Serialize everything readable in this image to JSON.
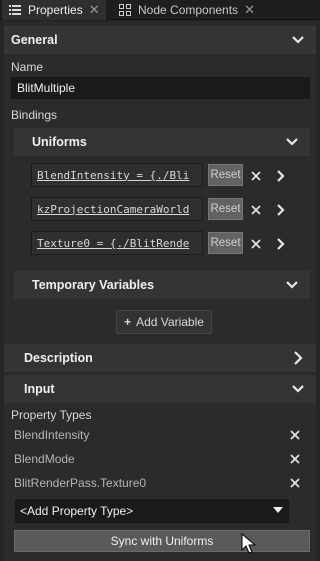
{
  "tabs": [
    {
      "label": "Properties",
      "icon": "list-icon"
    },
    {
      "label": "Node Components",
      "icon": "components-icon"
    }
  ],
  "sections": {
    "general": "General",
    "uniforms": "Uniforms",
    "temporary_variables": "Temporary Variables",
    "description": "Description",
    "input": "Input"
  },
  "name": {
    "label": "Name",
    "value": "BlitMultiple"
  },
  "bindings": {
    "label": "Bindings",
    "rows": [
      {
        "text": "BlendIntensity = {./Bli",
        "reset": "Reset"
      },
      {
        "text": "kzProjectionCameraWorld",
        "reset": "Reset"
      },
      {
        "text": "Texture0 = {./BlitRende",
        "reset": "Reset"
      }
    ],
    "add_variable": "Add Variable"
  },
  "property_types": {
    "label": "Property Types",
    "items": [
      "BlendIntensity",
      "BlendMode",
      "BlitRenderPass.Texture0"
    ],
    "add_placeholder": "<Add Property Type>"
  },
  "sync_button": "Sync with Uniforms",
  "colors": {
    "background": "#262626",
    "section_header": "#343434",
    "field": "#1a1a1a"
  }
}
